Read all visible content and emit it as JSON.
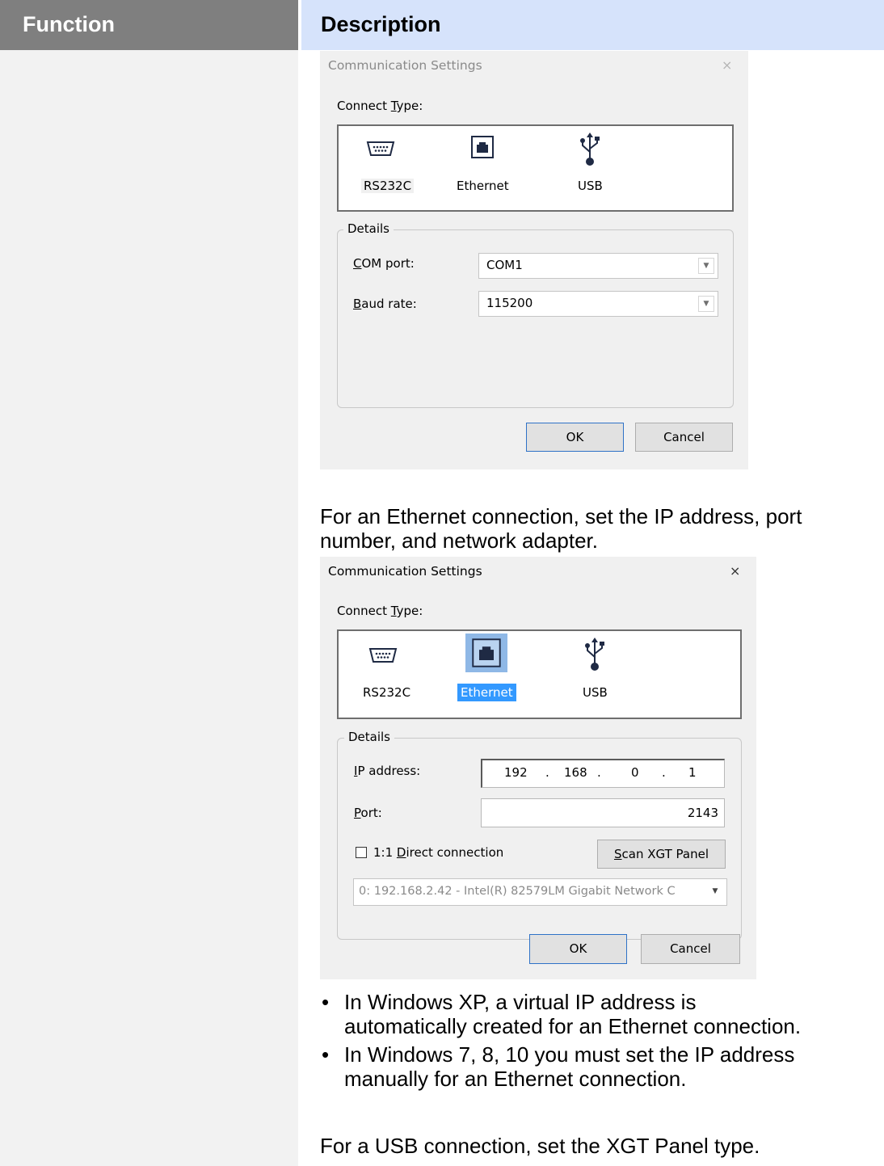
{
  "table": {
    "header_function": "Function",
    "header_description": "Description"
  },
  "dialog1": {
    "title": "Communication Settings",
    "close": "×",
    "connect_type_label": "Connect Type:",
    "types": [
      "RS232C",
      "Ethernet",
      "USB"
    ],
    "selected_type": "RS232C",
    "details_legend": "Details",
    "com_port_label": "COM port:",
    "com_port_value": "COM1",
    "baud_rate_label": "Baud rate:",
    "baud_rate_value": "115200",
    "ok": "OK",
    "cancel": "Cancel"
  },
  "para1": {
    "line1": "For an Ethernet connection, set the IP address, port",
    "line2": "number, and network adapter."
  },
  "dialog2": {
    "title": "Communication Settings",
    "close": "×",
    "connect_type_label": "Connect Type:",
    "types": [
      "RS232C",
      "Ethernet",
      "USB"
    ],
    "selected_type": "Ethernet",
    "details_legend": "Details",
    "ip_label": "IP address:",
    "ip_octets": [
      "192",
      "168",
      "0",
      "1"
    ],
    "ip_dot": ".",
    "port_label": "Port:",
    "port_value": "2143",
    "direct_label": "1:1 Direct connection",
    "direct_checked": false,
    "scan_button": "Scan XGT Panel",
    "adapter_value": "0: 192.168.2.42 - Intel(R) 82579LM Gigabit Network C",
    "ok": "OK",
    "cancel": "Cancel"
  },
  "bullets": [
    {
      "line1": "In Windows XP, a virtual IP address is",
      "line2": "automatically created for an Ethernet connection."
    },
    {
      "line1": "In Windows 7, 8, 10 you must set the IP address",
      "line2": "manually for an Ethernet connection."
    }
  ],
  "bullet_char": "•",
  "para2": "For a USB connection, set the XGT Panel type.",
  "colors": {
    "function_header_bg": "#7f7f7f",
    "description_header_bg": "#d6e3fb",
    "function_column_bg": "#f2f2f2",
    "dialog_bg": "#f0f0f0",
    "selection_blue": "#3399ff"
  }
}
